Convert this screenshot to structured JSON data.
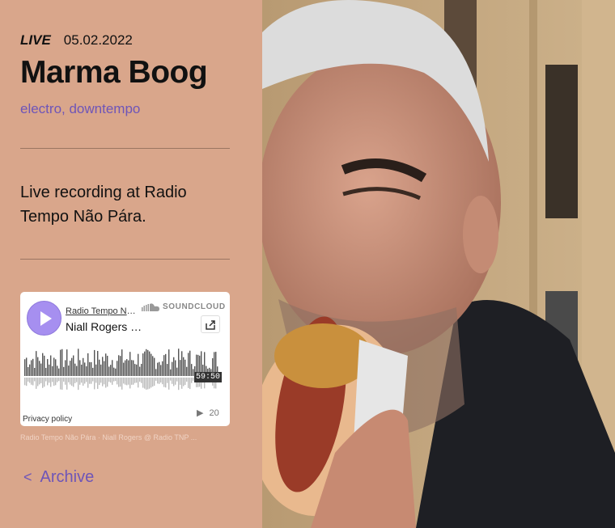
{
  "header": {
    "live_label": "LIVE",
    "date": "05.02.2022",
    "title": "Marma Boog",
    "genres": "electro, downtempo"
  },
  "description": "Live recording at Radio Tempo Não Pára.",
  "player": {
    "uploader": "Radio Tempo Não Pára",
    "track": "Niall Rogers @ Radio TNP",
    "brand": "SOUNDCLOUD",
    "duration": "59:50",
    "privacy_label": "Privacy policy",
    "play_count": "20",
    "play_icon": "play-icon",
    "share_icon": "share-icon"
  },
  "caption": "Radio Tempo Não Pára · Niall Rogers @ Radio TNP ...",
  "archive_label": "Archive",
  "colors": {
    "panel_bg": "#d9a68b",
    "accent": "#6e55b8",
    "play_button": "#a68ff0"
  },
  "photo_alt": "hero-photo"
}
